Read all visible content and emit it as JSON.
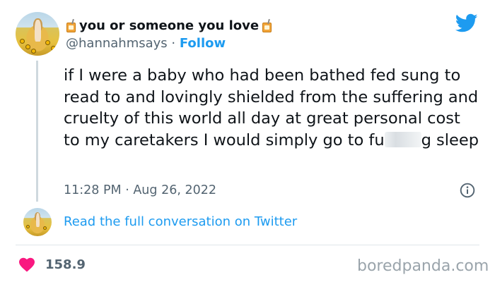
{
  "tweet": {
    "display_name": "you or someone you love",
    "name_emoji": "juice-box-icon",
    "handle": "@hannahmsays",
    "separator": " · ",
    "follow_label": "Follow",
    "text_before_blur": "if I were a baby who had been bathed fed sung to read to and lovingly shielded from the suffering and cruelty of this world all day at great personal cost to my caretakers I would simply go to fu",
    "text_after_blur": "g sleep",
    "timestamp": "11:28 PM · Aug 26, 2022",
    "conversation_link": "Read the full conversation on Twitter",
    "likes": "158.9",
    "icons": {
      "brand": "twitter-bird-icon",
      "info": "info-icon",
      "like": "heart-icon"
    }
  },
  "watermark": "boredpanda.com",
  "colors": {
    "accent": "#1d9bf0",
    "text": "#0f1419",
    "muted": "#536471",
    "heart": "#f91880",
    "divider": "#dfe6ea"
  }
}
